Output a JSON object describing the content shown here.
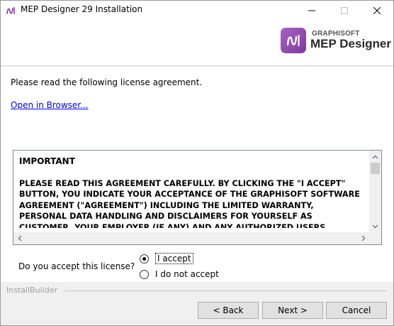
{
  "window": {
    "title": "MEP Designer 29 Installation",
    "controls": {
      "minimize": "—",
      "maximize": "☐",
      "close": "✕"
    }
  },
  "header": {
    "logo_brand": "GRAPHISOFT",
    "logo_product": "MEP Designer",
    "logo_icon": "mep-designer-logo",
    "accent_color": "#9b59b6"
  },
  "content": {
    "instruction": "Please read the following license agreement.",
    "browser_link": "Open in Browser...",
    "license": {
      "heading": "IMPORTANT",
      "lines": [
        "PLEASE READ THIS AGREEMENT CAREFULLY. BY CLICKING THE \"I ACCEPT\"",
        "BUTTON, YOU INDICATE YOUR ACCEPTANCE OF THE GRAPHISOFT SOFTWARE",
        "AGREEMENT (\"AGREEMENT\") INCLUDING THE LIMITED WARRANTY,",
        "PERSONAL DATA HANDLING AND DISCLAIMERS FOR YOURSELF AS",
        "CUSTOMER, YOUR EMPLOYER (IF ANY) AND ANY AUTHORIZED USERS"
      ]
    },
    "accept_question": "Do you accept this license?",
    "options": [
      {
        "label": "I accept",
        "selected": true
      },
      {
        "label": "I do not accept",
        "selected": false
      }
    ]
  },
  "footer": {
    "brand_label": "InstallBuilder",
    "back_label": "< Back",
    "next_label": "Next >",
    "cancel_label": "Cancel"
  }
}
